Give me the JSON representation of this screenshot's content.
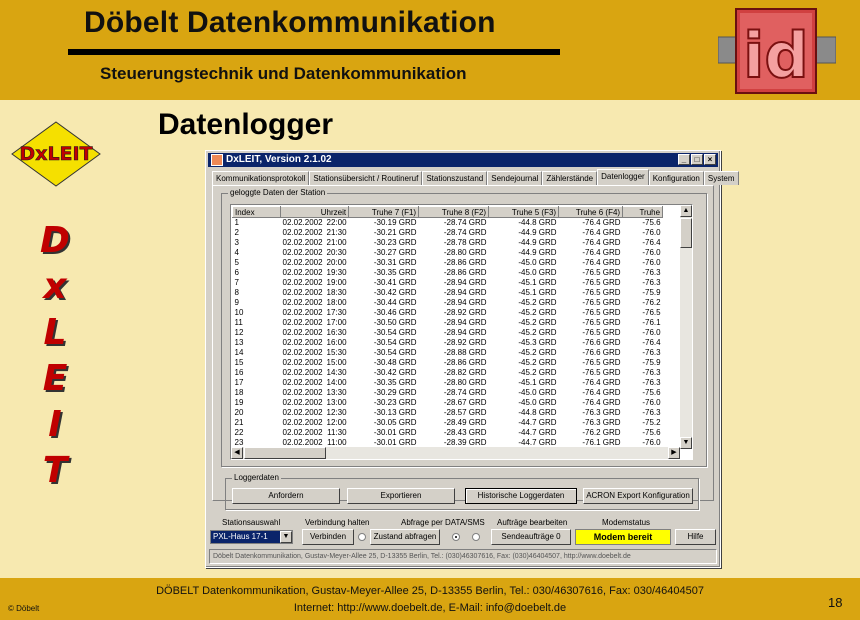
{
  "header": {
    "title": "Döbelt Datenkommunikation",
    "subtitle": "Steuerungstechnik und Datenkommunikation",
    "logo_text": "id"
  },
  "badge_text": "DxLEIT",
  "vertical_letters": [
    "D",
    "x",
    "L",
    "E",
    "I",
    "T"
  ],
  "page_title": "Datenlogger",
  "window": {
    "title": "DxLEIT, Version 2.1.02",
    "tabs": [
      "Kommunikationsprotokoll",
      "Stationsübersicht / Routineruf",
      "Stationszustand",
      "Sendejournal",
      "Zählerstände",
      "Datenlogger",
      "Konfiguration",
      "System"
    ],
    "active_tab": "Datenlogger",
    "group_data_label": "geloggte Daten der Station",
    "columns": [
      "Index",
      "Uhrzeit",
      "Truhe 7 (F1)",
      "Truhe 8 (F2)",
      "Truhe 5 (F3)",
      "Truhe 6 (F4)",
      "Truhe"
    ],
    "rows": [
      [
        "1",
        "02.02.2002",
        "22:00",
        "-30.19 GRD",
        "-28.74 GRD",
        "-44.8 GRD",
        "-76.4 GRD",
        "-75.6"
      ],
      [
        "2",
        "02.02.2002",
        "21:30",
        "-30.21 GRD",
        "-28.74 GRD",
        "-44.9 GRD",
        "-76.4 GRD",
        "-76.0"
      ],
      [
        "3",
        "02.02.2002",
        "21:00",
        "-30.23 GRD",
        "-28.78 GRD",
        "-44.9 GRD",
        "-76.4 GRD",
        "-76.4"
      ],
      [
        "4",
        "02.02.2002",
        "20:30",
        "-30.27 GRD",
        "-28.80 GRD",
        "-44.9 GRD",
        "-76.4 GRD",
        "-76.0"
      ],
      [
        "5",
        "02.02.2002",
        "20:00",
        "-30.31 GRD",
        "-28.86 GRD",
        "-45.0 GRD",
        "-76.4 GRD",
        "-76.0"
      ],
      [
        "6",
        "02.02.2002",
        "19:30",
        "-30.35 GRD",
        "-28.86 GRD",
        "-45.0 GRD",
        "-76.5 GRD",
        "-76.3"
      ],
      [
        "7",
        "02.02.2002",
        "19:00",
        "-30.41 GRD",
        "-28.94 GRD",
        "-45.1 GRD",
        "-76.5 GRD",
        "-76.3"
      ],
      [
        "8",
        "02.02.2002",
        "18:30",
        "-30.42 GRD",
        "-28.94 GRD",
        "-45.1 GRD",
        "-76.5 GRD",
        "-75.9"
      ],
      [
        "9",
        "02.02.2002",
        "18:00",
        "-30.44 GRD",
        "-28.94 GRD",
        "-45.2 GRD",
        "-76.5 GRD",
        "-76.2"
      ],
      [
        "10",
        "02.02.2002",
        "17:30",
        "-30.46 GRD",
        "-28.92 GRD",
        "-45.2 GRD",
        "-76.5 GRD",
        "-76.5"
      ],
      [
        "11",
        "02.02.2002",
        "17:00",
        "-30.50 GRD",
        "-28.94 GRD",
        "-45.2 GRD",
        "-76.5 GRD",
        "-76.1"
      ],
      [
        "12",
        "02.02.2002",
        "16:30",
        "-30.54 GRD",
        "-28.94 GRD",
        "-45.2 GRD",
        "-76.5 GRD",
        "-76.0"
      ],
      [
        "13",
        "02.02.2002",
        "16:00",
        "-30.54 GRD",
        "-28.92 GRD",
        "-45.3 GRD",
        "-76.6 GRD",
        "-76.4"
      ],
      [
        "14",
        "02.02.2002",
        "15:30",
        "-30.54 GRD",
        "-28.88 GRD",
        "-45.2 GRD",
        "-76.6 GRD",
        "-76.3"
      ],
      [
        "15",
        "02.02.2002",
        "15:00",
        "-30.48 GRD",
        "-28.86 GRD",
        "-45.2 GRD",
        "-76.5 GRD",
        "-75.9"
      ],
      [
        "16",
        "02.02.2002",
        "14:30",
        "-30.42 GRD",
        "-28.82 GRD",
        "-45.2 GRD",
        "-76.5 GRD",
        "-76.3"
      ],
      [
        "17",
        "02.02.2002",
        "14:00",
        "-30.35 GRD",
        "-28.80 GRD",
        "-45.1 GRD",
        "-76.4 GRD",
        "-76.3"
      ],
      [
        "18",
        "02.02.2002",
        "13:30",
        "-30.29 GRD",
        "-28.74 GRD",
        "-45.0 GRD",
        "-76.4 GRD",
        "-75.6"
      ],
      [
        "19",
        "02.02.2002",
        "13:00",
        "-30.23 GRD",
        "-28.67 GRD",
        "-45.0 GRD",
        "-76.4 GRD",
        "-76.0"
      ],
      [
        "20",
        "02.02.2002",
        "12:30",
        "-30.13 GRD",
        "-28.57 GRD",
        "-44.8 GRD",
        "-76.3 GRD",
        "-76.3"
      ],
      [
        "21",
        "02.02.2002",
        "12:00",
        "-30.05 GRD",
        "-28.49 GRD",
        "-44.7 GRD",
        "-76.3 GRD",
        "-75.2"
      ],
      [
        "22",
        "02.02.2002",
        "11:30",
        "-30.01 GRD",
        "-28.43 GRD",
        "-44.7 GRD",
        "-76.2 GRD",
        "-75.6"
      ],
      [
        "23",
        "02.02.2002",
        "11:00",
        "-30.01 GRD",
        "-28.39 GRD",
        "-44.7 GRD",
        "-76.1 GRD",
        "-76.0"
      ]
    ],
    "group_logger_label": "Loggerdaten",
    "logger_buttons": [
      "Anfordern",
      "Exportieren",
      "Historische Loggerdaten",
      "ACRON Export Konfiguration"
    ],
    "labels": {
      "station_select": "Stationsauswahl",
      "connection": "Verbindung  halten",
      "query": "Abfrage per   DATA/SMS",
      "jobs": "Aufträge bearbeiten",
      "modem": "Modemstatus"
    },
    "station_value": "PXL-Haus 17-1",
    "buttons": {
      "connect": "Verbinden",
      "state_query": "Zustand abfragen",
      "send_jobs": "Sendeaufträge 0",
      "help": "Hilfe"
    },
    "modem_status": "Modem bereit",
    "status_bar": "Döbelt Datenkommunikation, Gustav-Meyer-Allee 25, D-13355 Berlin, Tel.: (030)46307616, Fax: (030)46404507, http://www.doebelt.de"
  },
  "footer": {
    "line1": "DÖBELT Datenkommunikation, Gustav-Meyer-Allee 25, D-13355 Berlin, Tel.: 030/46307616, Fax: 030/46404507",
    "line2": "Internet: http://www.doebelt.de, E-Mail: info@doebelt.de",
    "copyright": "© Döbelt",
    "page_number": "18"
  },
  "colors": {
    "header_bg": "#d9a511",
    "page_bg": "#f7e9b0",
    "titlebar": "#0a246a",
    "modem_ok": "#ffff00",
    "letters": "#c00000"
  }
}
